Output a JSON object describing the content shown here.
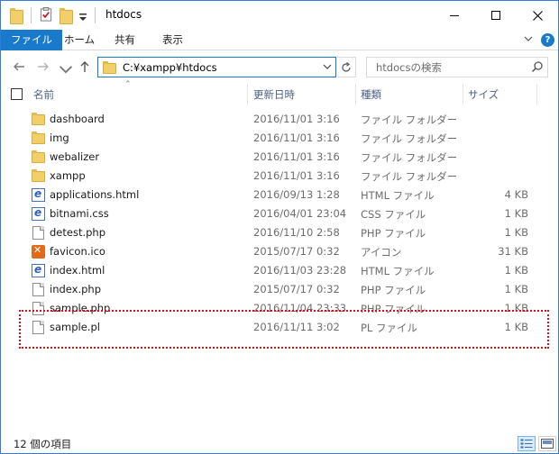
{
  "window": {
    "title": "htdocs"
  },
  "ribbon": {
    "tabs": [
      {
        "label": "ファイル",
        "active": true
      },
      {
        "label": "ホーム",
        "active": false
      },
      {
        "label": "共有",
        "active": false
      },
      {
        "label": "表示",
        "active": false
      }
    ]
  },
  "address": {
    "path": "C:¥xampp¥htdocs"
  },
  "search": {
    "placeholder": "htdocsの検索"
  },
  "columns": {
    "name": "名前",
    "date": "更新日時",
    "type": "種類",
    "size": "サイズ"
  },
  "files": [
    {
      "name": "dashboard",
      "date": "2016/11/01 3:16",
      "type": "ファイル フォルダー",
      "size": "",
      "icon": "folder-icon"
    },
    {
      "name": "img",
      "date": "2016/11/01 3:16",
      "type": "ファイル フォルダー",
      "size": "",
      "icon": "folder-icon"
    },
    {
      "name": "webalizer",
      "date": "2016/11/01 3:16",
      "type": "ファイル フォルダー",
      "size": "",
      "icon": "folder-icon"
    },
    {
      "name": "xampp",
      "date": "2016/11/01 3:16",
      "type": "ファイル フォルダー",
      "size": "",
      "icon": "folder-icon"
    },
    {
      "name": "applications.html",
      "date": "2016/09/13 1:28",
      "type": "HTML ファイル",
      "size": "4 KB",
      "icon": "html-file-icon"
    },
    {
      "name": "bitnami.css",
      "date": "2016/04/01 23:04",
      "type": "CSS ファイル",
      "size": "1 KB",
      "icon": "html-file-icon"
    },
    {
      "name": "detest.php",
      "date": "2016/11/10 2:58",
      "type": "PHP ファイル",
      "size": "1 KB",
      "icon": "document-icon"
    },
    {
      "name": "favicon.ico",
      "date": "2015/07/17 0:32",
      "type": "アイコン",
      "size": "31 KB",
      "icon": "xampp-icon"
    },
    {
      "name": "index.html",
      "date": "2016/11/03 23:28",
      "type": "HTML ファイル",
      "size": "1 KB",
      "icon": "html-file-icon"
    },
    {
      "name": "index.php",
      "date": "2015/07/17 0:32",
      "type": "PHP ファイル",
      "size": "1 KB",
      "icon": "document-icon"
    },
    {
      "name": "sample.php",
      "date": "2016/11/04 23:33",
      "type": "PHP ファイル",
      "size": "1 KB",
      "icon": "document-icon"
    },
    {
      "name": "sample.pl",
      "date": "2016/11/11 3:02",
      "type": "PL ファイル",
      "size": "1 KB",
      "icon": "document-icon"
    }
  ],
  "status": {
    "item_count": "12 個の項目"
  },
  "colors": {
    "accent": "#1979ca",
    "highlight_border": "#d0121b",
    "folder": "#f3cf6a"
  }
}
